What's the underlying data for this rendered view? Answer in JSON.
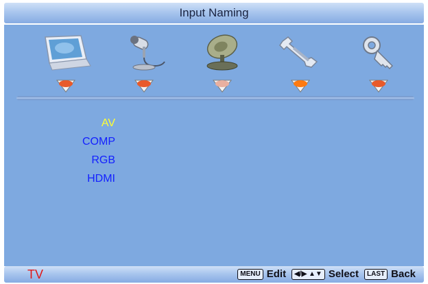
{
  "header": {
    "title": "Input Naming"
  },
  "tabs": [
    {
      "icon": "monitor-icon",
      "arrow_color": "#e85a2a",
      "active": false
    },
    {
      "icon": "microphone-icon",
      "arrow_color": "#e85a2a",
      "active": false
    },
    {
      "icon": "satellite-dish-icon",
      "arrow_color": "#e8b0a0",
      "active": false
    },
    {
      "icon": "wrench-icon",
      "arrow_color": "#ff7a10",
      "active": true
    },
    {
      "icon": "key-icon",
      "arrow_color": "#e85a2a",
      "active": false
    }
  ],
  "inputs": {
    "items": [
      {
        "label": "AV",
        "selected": true
      },
      {
        "label": "COMP",
        "selected": false
      },
      {
        "label": "RGB",
        "selected": false
      },
      {
        "label": "HDMI",
        "selected": false
      }
    ]
  },
  "footer": {
    "source": "TV",
    "edit_key": "MENU",
    "edit_label": "Edit",
    "select_key": "◀/▶ / ▲▼",
    "select_label": "Select",
    "back_key": "LAST",
    "back_label": "Back"
  },
  "colors": {
    "panel": "#7ea9e0",
    "selected_text": "#ffff33",
    "item_text": "#1420ff",
    "source_text": "#e01818"
  }
}
